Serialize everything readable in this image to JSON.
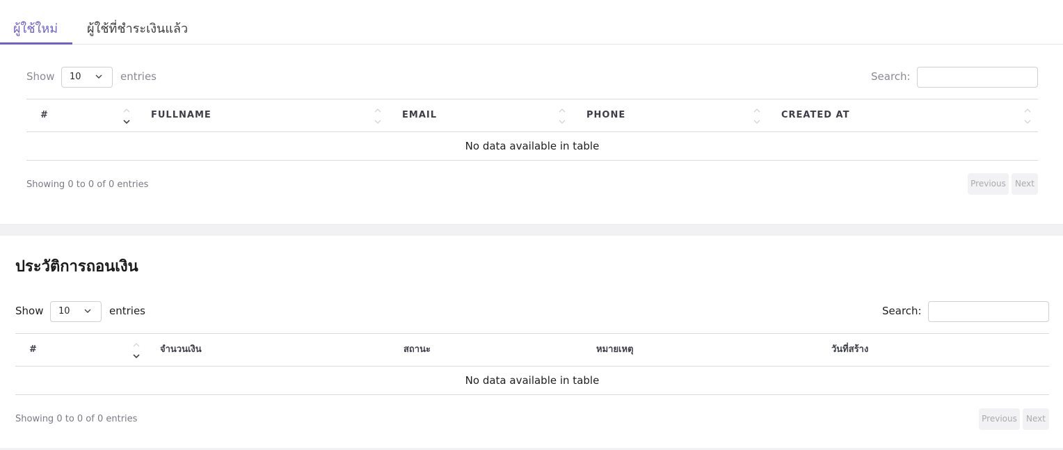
{
  "tabs": [
    {
      "label": "ผู้ใช้ใหม่"
    },
    {
      "label": "ผู้ใช้ที่ชำระเงินแล้ว"
    }
  ],
  "users_table": {
    "show_label": "Show",
    "length_value": "10",
    "entries_label": "entries",
    "search_label": "Search:",
    "columns": [
      "#",
      "FULLNAME",
      "EMAIL",
      "PHONE",
      "CREATED AT"
    ],
    "empty_text": "No data available in table",
    "info": "Showing 0 to 0 of 0 entries",
    "previous": "Previous",
    "next": "Next"
  },
  "withdraw": {
    "title": "ประวัติการถอนเงิน",
    "show_label": "Show",
    "length_value": "10",
    "entries_label": "entries",
    "search_label": "Search:",
    "columns": [
      "#",
      "จำนวนเงิน",
      "สถานะ",
      "หมายเหตุ",
      "วันที่สร้าง"
    ],
    "empty_text": "No data available in table",
    "info": "Showing 0 to 0 of 0 entries",
    "previous": "Previous",
    "next": "Next"
  },
  "colors": {
    "accent": "#6f5fd3",
    "border": "#dadade",
    "muted": "#7a7a84"
  }
}
